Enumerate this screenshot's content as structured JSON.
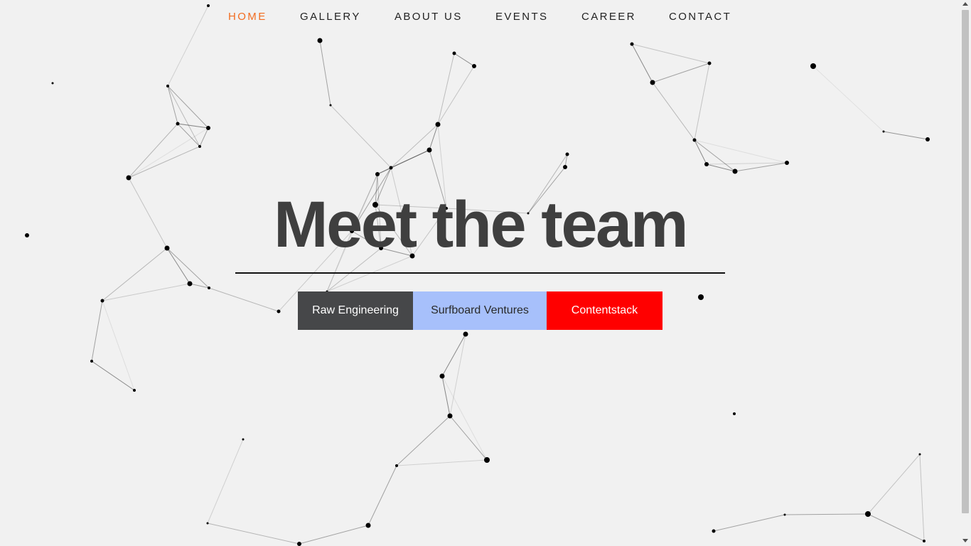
{
  "nav": {
    "items": [
      {
        "label": "HOME",
        "active": true
      },
      {
        "label": "GALLERY",
        "active": false
      },
      {
        "label": "ABOUT US",
        "active": false
      },
      {
        "label": "EVENTS",
        "active": false
      },
      {
        "label": "CAREER",
        "active": false
      },
      {
        "label": "CONTACT",
        "active": false
      }
    ]
  },
  "hero": {
    "title": "Meet the team"
  },
  "teams": [
    {
      "label": "Raw Engineering",
      "background": "#464749",
      "color": "#ffffff"
    },
    {
      "label": "Surfboard Ventures",
      "background": "#a7c0fb",
      "color": "#2a2a2a"
    },
    {
      "label": "Contentstack",
      "background": "#ff0000",
      "color": "#ffffff"
    }
  ],
  "colors": {
    "background": "#f1f1f1",
    "nav_text": "#222222",
    "nav_active": "#f26c20",
    "title": "#3f3f3f",
    "network_nodes": "#000000"
  },
  "decorations": {
    "background_icon": "particle-network"
  }
}
